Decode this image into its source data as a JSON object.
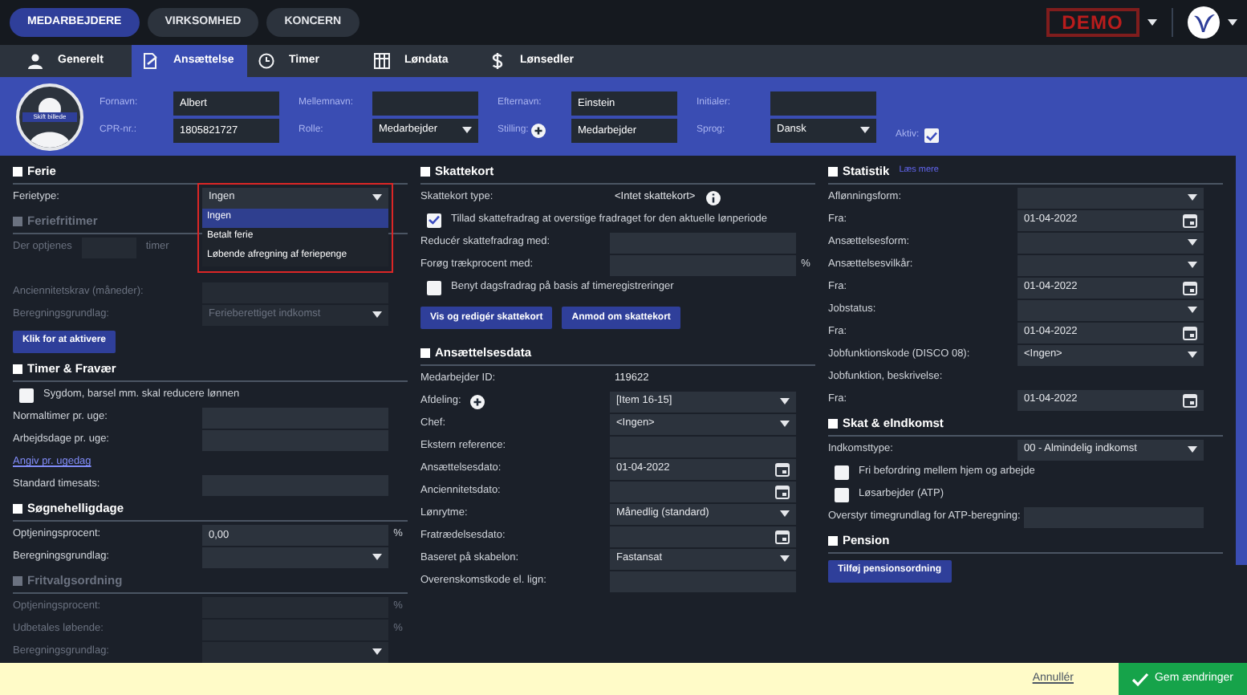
{
  "nav": [
    {
      "label": "MEDARBEJDERE",
      "selected": true
    },
    {
      "label": "VIRKSOMHED",
      "selected": false
    },
    {
      "label": "KONCERN",
      "selected": false
    }
  ],
  "demo_badge": "DEMO",
  "tabs": [
    {
      "label": "Generelt",
      "selected": false
    },
    {
      "label": "Ansættelse",
      "selected": true
    },
    {
      "label": "Timer",
      "selected": false
    },
    {
      "label": "Løndata",
      "selected": false
    },
    {
      "label": "Lønsedler",
      "selected": false
    }
  ],
  "profile": {
    "avatar_label": "Skift billede",
    "fields": [
      {
        "kind": "input",
        "label": "Fornavn:",
        "value": "Albert"
      },
      {
        "kind": "input",
        "label": "CPR-nr.:",
        "value": "1805821727"
      },
      {
        "kind": "input",
        "label": "Mellemnavn:"
      },
      {
        "kind": "select",
        "label": "Rolle:",
        "value": "Medarbejder"
      },
      {
        "kind": "input",
        "label": "Efternavn:",
        "value": "Einstein"
      },
      {
        "kind": "input",
        "label": "Stilling:",
        "value": "Medarbejder",
        "add_icon": true
      },
      {
        "kind": "input",
        "label": "Initialer:"
      },
      {
        "kind": "select",
        "label": "Sprog:",
        "value": "Dansk"
      }
    ],
    "active": {
      "label": "Aktiv:",
      "checked": true
    }
  },
  "columns": [
    {
      "sections": [
        {
          "title": "Ferie",
          "disabled": false,
          "rows": [
            {
              "kind": "select",
              "label": "Ferietype:",
              "value": "Ingen",
              "options": [
                {
                  "label": "Ingen",
                  "selected": true
                },
                {
                  "label": "Betalt ferie",
                  "selected": false
                },
                {
                  "label": "Løbende afregning af feriepenge",
                  "selected": false
                }
              ]
            }
          ]
        },
        {
          "title": "Feriefritimer",
          "disabled": true,
          "rows": [
            {
              "kind": "inline",
              "label": "Der optjenes",
              "after": "timer"
            },
            {
              "kind": "spacer"
            },
            {
              "kind": "input",
              "label": "Anciennitetskrav (måneder):"
            },
            {
              "kind": "select",
              "label": "Beregningsgrundlag:",
              "value": "Ferieberettiget indkomst"
            },
            {
              "kind": "button",
              "label": "Klik for at aktivere"
            }
          ]
        },
        {
          "title": "Timer & Fravær",
          "disabled": false,
          "rows": [
            {
              "kind": "check",
              "label": "Sygdom, barsel mm. skal reducere lønnen",
              "checked": false
            },
            {
              "kind": "input",
              "label": "Normaltimer pr. uge:"
            },
            {
              "kind": "input",
              "label": "Arbejdsdage pr. uge:"
            },
            {
              "kind": "link",
              "label": "Angiv pr. ugedag"
            },
            {
              "kind": "input",
              "label": "Standard timesats:"
            }
          ]
        },
        {
          "title": "Søgnehelligdage",
          "disabled": false,
          "rows": [
            {
              "kind": "input",
              "label": "Optjeningsprocent:",
              "value": "0,00",
              "suffix": "%"
            },
            {
              "kind": "select",
              "label": "Beregningsgrundlag:"
            }
          ]
        },
        {
          "title": "Fritvalgsordning",
          "disabled": true,
          "rows": [
            {
              "kind": "input",
              "label": "Optjeningsprocent:",
              "suffix": "%"
            },
            {
              "kind": "input",
              "label": "Udbetales løbende:",
              "suffix": "%"
            },
            {
              "kind": "select",
              "label": "Beregningsgrundlag:"
            }
          ]
        }
      ]
    },
    {
      "sections": [
        {
          "title": "Skattekort",
          "disabled": false,
          "rows": [
            {
              "kind": "text",
              "label": "Skattekort type:",
              "value": "<Intet skattekort>",
              "info": true
            },
            {
              "kind": "check",
              "label": "Tillad skattefradrag at overstige fradraget for den aktuelle lønperiode",
              "checked": true
            },
            {
              "kind": "input",
              "label": "Reducér skattefradrag med:"
            },
            {
              "kind": "input",
              "label": "Forøg trækprocent med:",
              "suffix": "%"
            },
            {
              "kind": "check",
              "label": "Benyt dagsfradrag på basis af timeregistreringer",
              "checked": false
            },
            {
              "kind": "buttons",
              "labels": [
                "Vis og redigér skattekort",
                "Anmod om skattekort"
              ]
            }
          ]
        },
        {
          "title": "Ansættelsesdata",
          "disabled": false,
          "rows": [
            {
              "kind": "text",
              "label": "Medarbejder ID:",
              "value": "119622"
            },
            {
              "kind": "select",
              "label": "Afdeling:",
              "value": "[Item 16-15]",
              "add_icon": true
            },
            {
              "kind": "select",
              "label": "Chef:",
              "value": "<Ingen>"
            },
            {
              "kind": "input",
              "label": "Ekstern reference:"
            },
            {
              "kind": "date",
              "label": "Ansættelsesdato:",
              "value": "01-04-2022"
            },
            {
              "kind": "date",
              "label": "Anciennitetsdato:"
            },
            {
              "kind": "select",
              "label": "Lønrytme:",
              "value": "Månedlig (standard)"
            },
            {
              "kind": "date",
              "label": "Fratrædelsesdato:"
            },
            {
              "kind": "select",
              "label": "Baseret på skabelon:",
              "value": "Fastansat"
            },
            {
              "kind": "input",
              "label": "Overenskomstkode el. lign:"
            }
          ]
        }
      ]
    },
    {
      "sections": [
        {
          "title": "Statistik",
          "link": "Læs mere",
          "disabled": false,
          "rows": [
            {
              "kind": "select",
              "label": "Aflønningsform:"
            },
            {
              "kind": "date",
              "label": "Fra:",
              "value": "01-04-2022"
            },
            {
              "kind": "select",
              "label": "Ansættelsesform:"
            },
            {
              "kind": "select",
              "label": "Ansættelsesvilkår:"
            },
            {
              "kind": "date",
              "label": "Fra:",
              "value": "01-04-2022"
            },
            {
              "kind": "select",
              "label": "Jobstatus:"
            },
            {
              "kind": "date",
              "label": "Fra:",
              "value": "01-04-2022"
            },
            {
              "kind": "select",
              "label": "Jobfunktionskode (DISCO 08):",
              "value": "<Ingen>"
            },
            {
              "kind": "text",
              "label": "Jobfunktion, beskrivelse:"
            },
            {
              "kind": "date",
              "label": "Fra:",
              "value": "01-04-2022"
            }
          ]
        },
        {
          "title": "Skat & eIndkomst",
          "disabled": false,
          "rows": [
            {
              "kind": "select",
              "label": "Indkomsttype:",
              "value": "00 - Almindelig indkomst"
            },
            {
              "kind": "check",
              "label": "Fri befordring mellem hjem og arbejde",
              "checked": false
            },
            {
              "kind": "check",
              "label": "Løsarbejder (ATP)",
              "checked": false
            },
            {
              "kind": "input",
              "label": "Overstyr timegrundlag for ATP-beregning:"
            }
          ]
        },
        {
          "title": "Pension",
          "disabled": false,
          "rows": [
            {
              "kind": "button",
              "label": "Tilføj pensionsordning"
            }
          ]
        }
      ]
    }
  ],
  "footer": {
    "cancel": "Annullér",
    "save": "Gem ændringer"
  }
}
